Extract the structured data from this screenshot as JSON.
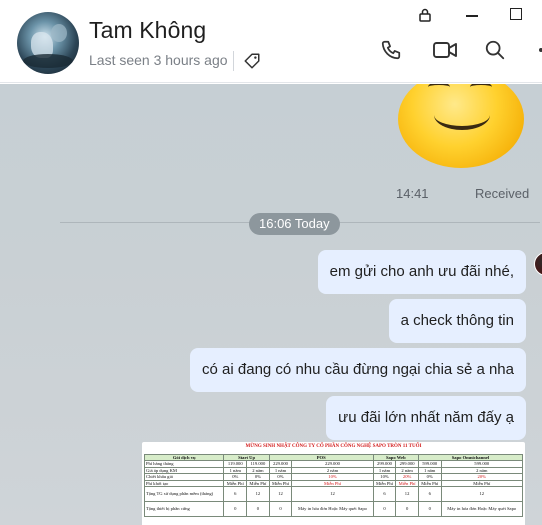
{
  "header": {
    "contact_name": "Tam Không",
    "last_seen": "Last seen 3 hours ago"
  },
  "icons": {
    "lock": "lock-icon",
    "minimize": "minimize-icon",
    "maximize": "maximize-icon",
    "tag": "tag-icon",
    "call": "phone-icon",
    "video": "video-camera-icon",
    "search": "search-icon"
  },
  "sticker_message": {
    "time": "14:41",
    "status": "Received"
  },
  "date_divider": "16:06 Today",
  "messages": [
    {
      "text": "em gửi cho anh ưu đãi nhé,"
    },
    {
      "text": "a check thông tin"
    },
    {
      "text": "có ai đang có nhu cầu đừng ngại chia sẻ a nha"
    },
    {
      "text": "ưu đãi lớn nhất năm đấy ạ"
    }
  ],
  "attachment": {
    "title": "MỪNG SINH NHẬT CÔNG TY CỔ PHẦN CÔNG NGHỆ SAPO TRÒN 11 TUỔI",
    "header": [
      "Gói dịch vụ",
      "Start Up",
      "",
      "POS",
      "",
      "Sapo Web",
      "",
      "Sapo Omnichannel",
      ""
    ],
    "rows": [
      [
        "Phí hàng tháng",
        "119.000",
        "119.000",
        "229.000",
        "229.000",
        "299.000",
        "299.000",
        "599.000",
        "599.000"
      ],
      [
        "Giá áp dụng KM",
        "1 năm",
        "2 năm",
        "1 năm",
        "2 năm",
        "1 năm",
        "2 năm",
        "1 năm",
        "2 năm"
      ],
      [
        "Chiết khấu giá",
        "0%",
        "0%",
        "0%",
        "10%",
        "10%",
        "20%",
        "0%",
        "20%"
      ],
      [
        "Phí khởi tạo",
        "Miễn Phí",
        "Miễn Phí",
        "Miễn Phí",
        "Miễn Phí",
        "Miễn Phí",
        "Miễn Phí",
        "Miễn Phí",
        "Miễn Phí"
      ],
      [
        "Tặng TG sử dụng phần mềm (tháng)",
        "6",
        "12",
        "12",
        "12",
        "6",
        "12",
        "6",
        "12"
      ],
      [
        "Tặng thiết bị phần cứng",
        "0",
        "0",
        "0",
        "Máy in hóa đơn Hoặc Máy quét Sapo",
        "0",
        "0",
        "0",
        "Máy in hóa đơn Hoặc Máy quét Sapo"
      ]
    ],
    "colors": {
      "header_bg": "#d7ecc9",
      "title": "#d21a1a"
    }
  },
  "colors": {
    "bubble_bg": "#e6efff",
    "chat_bg": "#c9d0d4",
    "date_pill_bg": "#8d979d"
  }
}
